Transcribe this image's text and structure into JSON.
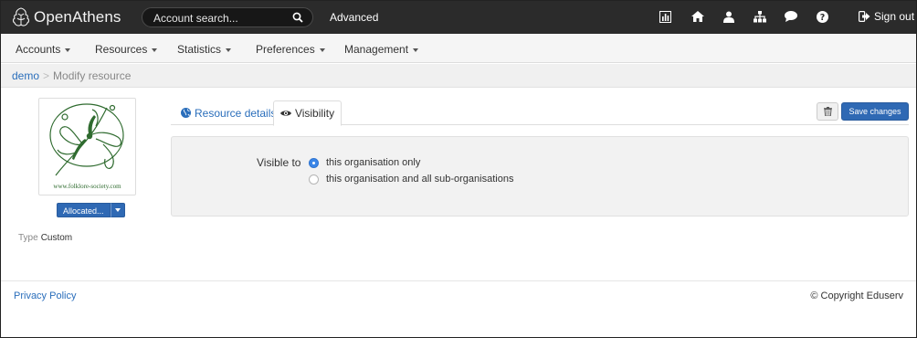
{
  "header": {
    "brand": "OpenAthens",
    "search_placeholder": "Account search...",
    "advanced_label": "Advanced",
    "icons": [
      "statistics-icon",
      "home-icon",
      "user-icon",
      "sitemap-icon",
      "comment-icon",
      "help-icon"
    ],
    "signout_label": "Sign out"
  },
  "menu": {
    "items": [
      {
        "label": "Accounts"
      },
      {
        "label": "Resources"
      },
      {
        "label": "Statistics"
      },
      {
        "label": "Preferences"
      },
      {
        "label": "Management"
      }
    ]
  },
  "breadcrumb": {
    "home": "demo",
    "separator": ">",
    "current": "Modify resource"
  },
  "resource": {
    "logo_caption": "www.folklore-society.com",
    "allocation_label": "Allocated...",
    "type_label": "Type",
    "type_value": "Custom"
  },
  "tabs": [
    {
      "label": "Resource details",
      "icon": "globe-icon",
      "active": false
    },
    {
      "label": "Visibility",
      "icon": "eye-icon",
      "active": true
    }
  ],
  "actions": {
    "delete_icon": "trash-icon",
    "save_label": "Save changes"
  },
  "visibility": {
    "label": "Visible to",
    "options": [
      {
        "label": "this organisation only",
        "selected": true
      },
      {
        "label": "this organisation and all sub-organisations",
        "selected": false
      }
    ]
  },
  "footer": {
    "privacy_label": "Privacy Policy",
    "copyright": "© Copyright Eduserv"
  },
  "colors": {
    "topbar": "#2b2b2b",
    "accent": "#2f69b4",
    "link": "#2a6ebb",
    "logo_green": "#2f6b2f"
  }
}
